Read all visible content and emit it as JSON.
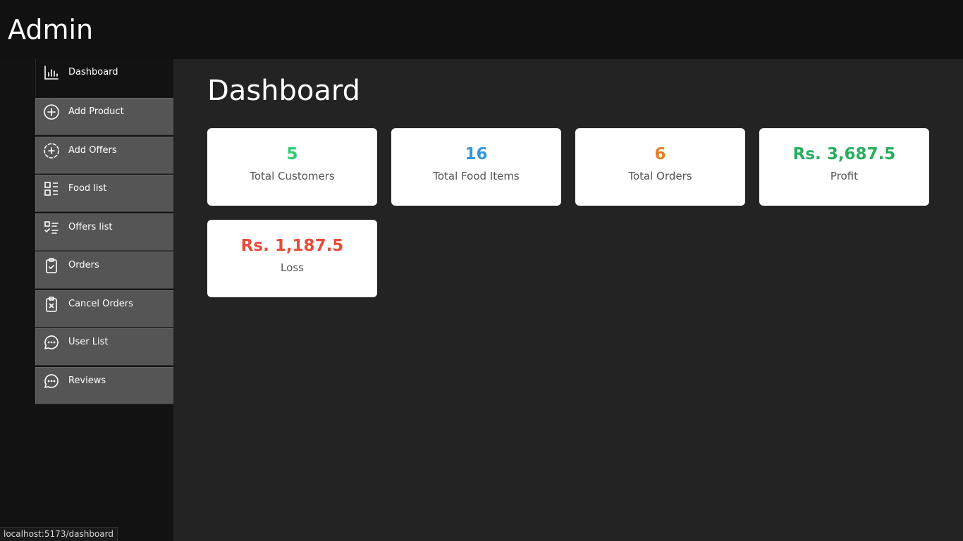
{
  "app": {
    "title": "Admin"
  },
  "sidebar": {
    "items": [
      {
        "label": "Dashboard",
        "icon": "bar-chart-icon",
        "active": true
      },
      {
        "label": "Add Product",
        "icon": "plus-circle-icon"
      },
      {
        "label": "Add Offers",
        "icon": "dashed-plus-circle-icon"
      },
      {
        "label": "Food list",
        "icon": "list-grid-icon"
      },
      {
        "label": "Offers list",
        "icon": "checklist-icon"
      },
      {
        "label": "Orders",
        "icon": "clipboard-check-icon"
      },
      {
        "label": "Cancel Orders",
        "icon": "clipboard-x-icon"
      },
      {
        "label": "User List",
        "icon": "chat-bubble-icon"
      },
      {
        "label": "Reviews",
        "icon": "chat-bubble-icon"
      }
    ]
  },
  "main": {
    "title": "Dashboard",
    "cards": [
      {
        "value": "5",
        "label": "Total Customers",
        "color": "#2ecc71"
      },
      {
        "value": "16",
        "label": "Total Food Items",
        "color": "#3498db"
      },
      {
        "value": "6",
        "label": "Total Orders",
        "color": "#e67e22"
      },
      {
        "value": "Rs. 3,687.5",
        "label": "Profit",
        "color": "#27ae60"
      },
      {
        "value": "Rs. 1,187.5",
        "label": "Loss",
        "color": "#e74c3c"
      }
    ]
  },
  "status": {
    "url": "localhost:5173/dashboard"
  }
}
